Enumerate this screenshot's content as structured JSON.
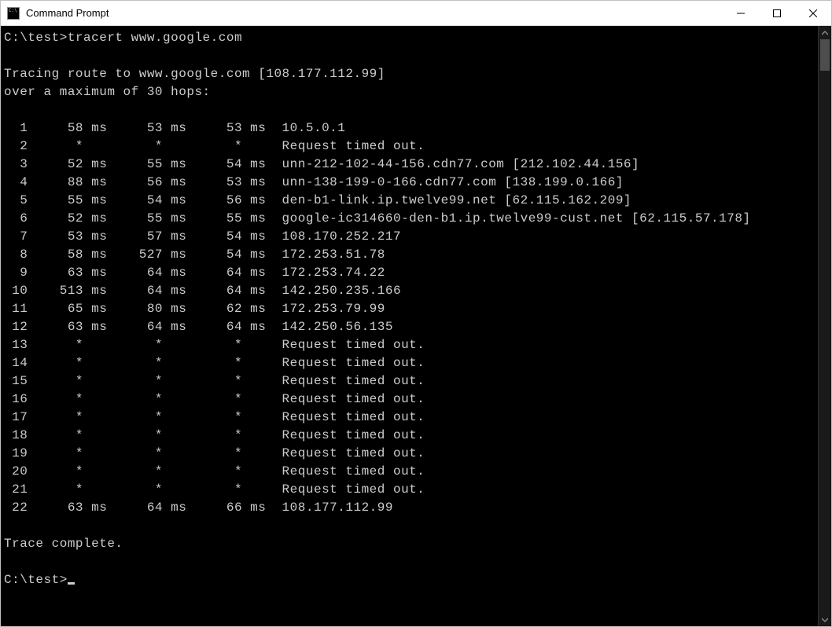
{
  "window": {
    "title": "Command Prompt"
  },
  "session": {
    "prompt1": "C:\\test>",
    "cmd1": "tracert www.google.com",
    "tracing_line": "Tracing route to www.google.com [108.177.112.99]",
    "max_hops_line": "over a maximum of 30 hops:",
    "complete": "Trace complete.",
    "prompt2": "C:\\test>"
  },
  "hops": [
    {
      "n": "1",
      "t1": "58 ms",
      "t2": "53 ms",
      "t3": "53 ms",
      "host": "10.5.0.1"
    },
    {
      "n": "2",
      "t1": "*",
      "t2": "*",
      "t3": "*",
      "host": "Request timed out."
    },
    {
      "n": "3",
      "t1": "52 ms",
      "t2": "55 ms",
      "t3": "54 ms",
      "host": "unn-212-102-44-156.cdn77.com [212.102.44.156]"
    },
    {
      "n": "4",
      "t1": "88 ms",
      "t2": "56 ms",
      "t3": "53 ms",
      "host": "unn-138-199-0-166.cdn77.com [138.199.0.166]"
    },
    {
      "n": "5",
      "t1": "55 ms",
      "t2": "54 ms",
      "t3": "56 ms",
      "host": "den-b1-link.ip.twelve99.net [62.115.162.209]"
    },
    {
      "n": "6",
      "t1": "52 ms",
      "t2": "55 ms",
      "t3": "55 ms",
      "host": "google-ic314660-den-b1.ip.twelve99-cust.net [62.115.57.178]"
    },
    {
      "n": "7",
      "t1": "53 ms",
      "t2": "57 ms",
      "t3": "54 ms",
      "host": "108.170.252.217"
    },
    {
      "n": "8",
      "t1": "58 ms",
      "t2": "527 ms",
      "t3": "54 ms",
      "host": "172.253.51.78"
    },
    {
      "n": "9",
      "t1": "63 ms",
      "t2": "64 ms",
      "t3": "64 ms",
      "host": "172.253.74.22"
    },
    {
      "n": "10",
      "t1": "513 ms",
      "t2": "64 ms",
      "t3": "64 ms",
      "host": "142.250.235.166"
    },
    {
      "n": "11",
      "t1": "65 ms",
      "t2": "80 ms",
      "t3": "62 ms",
      "host": "172.253.79.99"
    },
    {
      "n": "12",
      "t1": "63 ms",
      "t2": "64 ms",
      "t3": "64 ms",
      "host": "142.250.56.135"
    },
    {
      "n": "13",
      "t1": "*",
      "t2": "*",
      "t3": "*",
      "host": "Request timed out."
    },
    {
      "n": "14",
      "t1": "*",
      "t2": "*",
      "t3": "*",
      "host": "Request timed out."
    },
    {
      "n": "15",
      "t1": "*",
      "t2": "*",
      "t3": "*",
      "host": "Request timed out."
    },
    {
      "n": "16",
      "t1": "*",
      "t2": "*",
      "t3": "*",
      "host": "Request timed out."
    },
    {
      "n": "17",
      "t1": "*",
      "t2": "*",
      "t3": "*",
      "host": "Request timed out."
    },
    {
      "n": "18",
      "t1": "*",
      "t2": "*",
      "t3": "*",
      "host": "Request timed out."
    },
    {
      "n": "19",
      "t1": "*",
      "t2": "*",
      "t3": "*",
      "host": "Request timed out."
    },
    {
      "n": "20",
      "t1": "*",
      "t2": "*",
      "t3": "*",
      "host": "Request timed out."
    },
    {
      "n": "21",
      "t1": "*",
      "t2": "*",
      "t3": "*",
      "host": "Request timed out."
    },
    {
      "n": "22",
      "t1": "63 ms",
      "t2": "64 ms",
      "t3": "66 ms",
      "host": "108.177.112.99"
    }
  ]
}
